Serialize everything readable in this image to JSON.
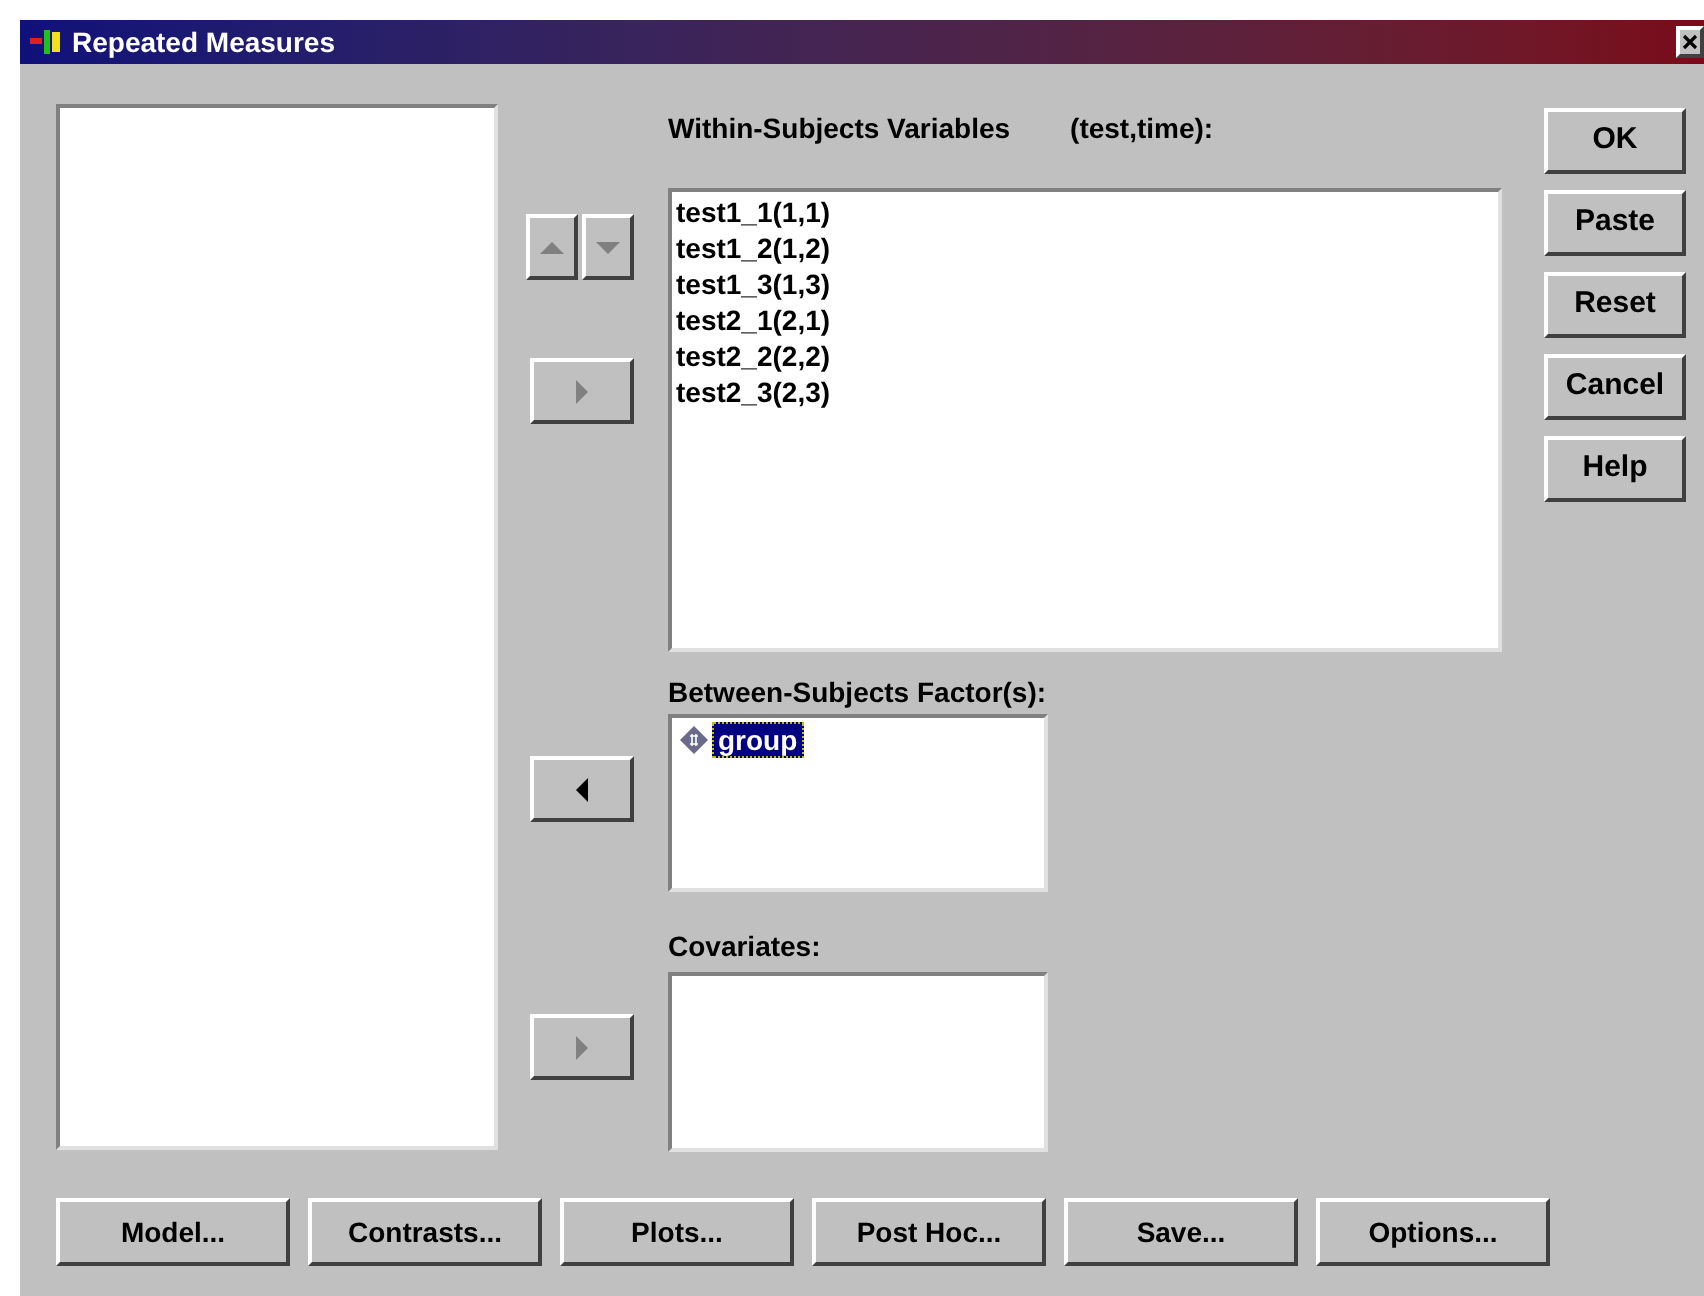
{
  "window": {
    "title": "Repeated Measures"
  },
  "within_subjects": {
    "label": "Within-Subjects Variables",
    "hint": "(test,time):",
    "items": [
      "test1_1(1,1)",
      "test1_2(1,2)",
      "test1_3(1,3)",
      "test2_1(2,1)",
      "test2_2(2,2)",
      "test2_3(2,3)"
    ]
  },
  "order_buttons": [
    {
      "kind": "up",
      "disabled": true
    },
    {
      "kind": "down",
      "disabled": true
    }
  ],
  "move_buttons": [
    {
      "kind": "right",
      "disabled": true
    },
    {
      "kind": "left",
      "disabled": false
    },
    {
      "kind": "right",
      "disabled": true
    }
  ],
  "between_subjects": {
    "label": "Between-Subjects Factor(s):",
    "items": [
      {
        "name": "group",
        "selected": true
      }
    ]
  },
  "covariates": {
    "label": "Covariates:"
  },
  "side_buttons": [
    "OK",
    "Paste",
    "Reset",
    "Cancel",
    "Help"
  ],
  "bottom_buttons": [
    "Model...",
    "Contrasts...",
    "Plots...",
    "Post Hoc...",
    "Save...",
    "Options..."
  ]
}
